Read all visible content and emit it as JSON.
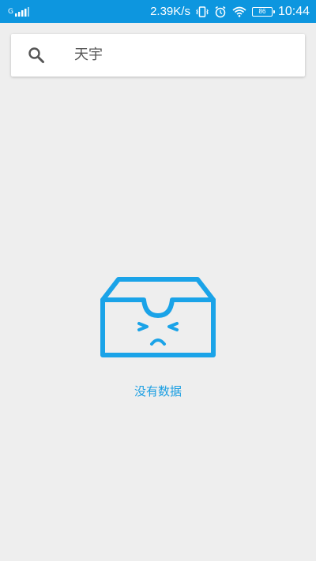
{
  "status_bar": {
    "signal_label": "G",
    "network_speed": "2.39K/s",
    "battery_level": "86",
    "time": "10:44",
    "icons": [
      "signal-icon",
      "vibrate-icon",
      "alarm-icon",
      "wifi-icon",
      "battery-icon"
    ]
  },
  "search": {
    "query": "天宇",
    "icon": "search-icon"
  },
  "empty_state": {
    "icon": "empty-box-icon",
    "message": "没有数据"
  },
  "colors": {
    "status_bar_bg": "#0d96df",
    "page_bg": "#eeeeee",
    "accent": "#1a9ee2"
  }
}
